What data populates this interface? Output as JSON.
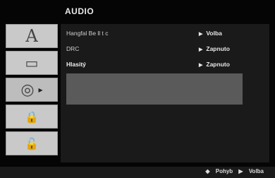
{
  "header": {
    "title": "AUDIO"
  },
  "sidebar": {
    "items": [
      {
        "icon": "letter-a-icon",
        "glyph": "A",
        "active": false
      },
      {
        "icon": "screen-icon",
        "glyph": "▭",
        "active": false
      },
      {
        "icon": "sphere-icon",
        "glyph": "◎",
        "active": true,
        "arrow": "▶"
      },
      {
        "icon": "lock-icon",
        "glyph": "🔒",
        "active": false
      },
      {
        "icon": "unlock-icon",
        "glyph": "🔓",
        "active": false
      }
    ]
  },
  "menu": {
    "rows": [
      {
        "label": "Hangfal Be ll t c",
        "value": "Volba"
      },
      {
        "label": "DRC",
        "value": "Zapnuto"
      },
      {
        "label": "Hlasitý",
        "value": "Zapnuto"
      }
    ]
  },
  "footer": {
    "move": "Pohyb",
    "select": "Volba",
    "move_icon": "◆",
    "select_icon": "▶"
  }
}
